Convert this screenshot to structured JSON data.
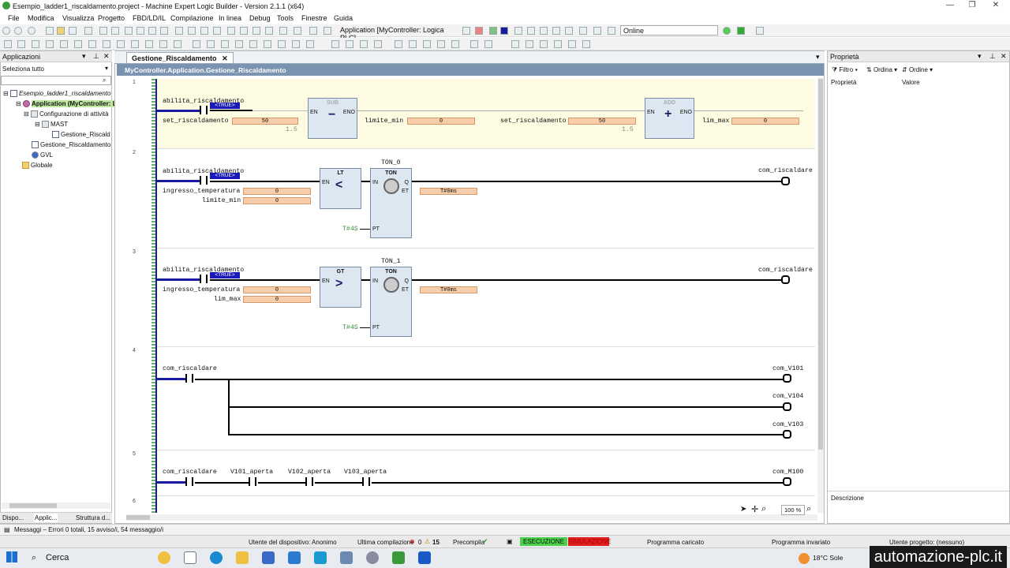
{
  "window": {
    "title": "Esempio_ladder1_riscaldamento.project - Machine Expert Logic Builder - Version 2.1.1 (x64)"
  },
  "menu": [
    "File",
    "Modifica",
    "Visualizza",
    "Progetto",
    "FBD/LD/IL",
    "Compilazione",
    "In linea",
    "Debug",
    "Tools",
    "Finestre",
    "Guida"
  ],
  "toolbar": {
    "application": "Application [MyController: Logica PLC]",
    "mode": "Online"
  },
  "left_panel": {
    "title": "Applicazioni",
    "filter": "Seleziona tutto",
    "tree": [
      "Esempio_ladder1_riscaldamento",
      "Application (MyController: Logica PLC)",
      "Configurazione di attività",
      "MAST",
      "Gestione_Riscaldamento",
      "Gestione_Riscaldamento (PRG)",
      "GVL",
      "Globale"
    ],
    "tabs": [
      "Dispo...",
      "Applic...",
      "Struttura d..."
    ]
  },
  "editor": {
    "tab": "Gestione_Riscaldamento",
    "path": "MyController.Application.Gestione_Riscaldamento",
    "zoom": "100 %",
    "rungs": [
      {
        "num": "1",
        "contact": "abilita_riscaldamento",
        "true_label": "<TRUE>",
        "in1": "set_riscaldamento",
        "v1": "50",
        "c1": "1.5",
        "fb1": "SUB",
        "out1": "limite_min",
        "ov1": "0",
        "in2": "set_riscaldamento",
        "v2": "50",
        "c2": "1.5",
        "fb2": "ADD",
        "out2": "lim_max",
        "ov2": "0",
        "en": "EN",
        "eno": "ENO"
      },
      {
        "num": "2",
        "contact": "abilita_riscaldamento",
        "true_label": "<TRUE>",
        "in1": "ingresso_temperatura",
        "v1": "0",
        "in2": "limite_min",
        "v2": "0",
        "cmp": "LT",
        "timer": "TON_0",
        "tname": "TON",
        "et": "T#0ms",
        "pt": "T#4S",
        "coil": "com_riscaldare",
        "en": "EN",
        "in": "IN",
        "q": "Q",
        "etl": "ET",
        "ptl": "PT"
      },
      {
        "num": "3",
        "contact": "abilita_riscaldamento",
        "true_label": "<TRUE>",
        "in1": "ingresso_temperatura",
        "v1": "0",
        "in2": "lim_max",
        "v2": "0",
        "cmp": "GT",
        "timer": "TON_1",
        "tname": "TON",
        "et": "T#0ms",
        "pt": "T#4S",
        "coil": "com_riscaldare",
        "en": "EN",
        "in": "IN",
        "q": "Q",
        "etl": "ET",
        "ptl": "PT"
      },
      {
        "num": "4",
        "contact": "com_riscaldare",
        "coils": [
          "com_V101",
          "com_V104",
          "com_V103"
        ]
      },
      {
        "num": "5",
        "contacts": [
          "com_riscaldare",
          "V101_aperta",
          "V102_aperta",
          "V103_aperta"
        ],
        "coil": "com_M100"
      },
      {
        "num": "6"
      }
    ]
  },
  "properties": {
    "title": "Proprietà",
    "filter": "Filtro",
    "order1": "Ordina",
    "order2": "Ordine",
    "col1": "Proprietà",
    "col2": "Valore",
    "desc": "Descrizione"
  },
  "messages": "Messaggi – Errori 0 totali, 15 avviso/i, 54 messaggio/i",
  "status": {
    "user": "Utente del dispositivo: Anonimo",
    "last_build": "Ultima compilazione",
    "errors": "0",
    "warnings": "15",
    "precompile": "Precompila",
    "run": "ESECUZIONE",
    "sim": "SIMULAZIONE",
    "loaded": "Programma caricato",
    "unchanged": "Programma invariato",
    "proj_user": "Utente progetto: (nessuno)"
  },
  "taskbar": {
    "search": "Cerca",
    "weather": "18°C Sole",
    "brand": "automazione-plc.it"
  },
  "colors": {
    "rail": "#1a1aa0",
    "valbox": "#f8ceaa",
    "run": "#4bd14b",
    "sim": "#e02020",
    "selected_rung": "#fdfbe2"
  }
}
